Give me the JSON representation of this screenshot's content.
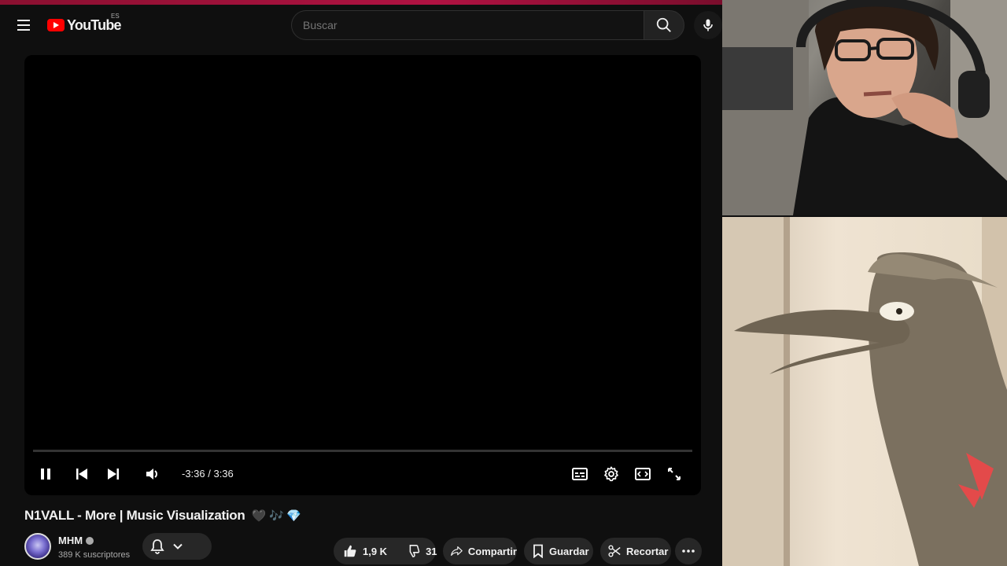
{
  "masthead": {
    "logo_text": "YouTube",
    "region": "ES",
    "search_placeholder": "Buscar"
  },
  "player": {
    "time": "-3:36 / 3:36",
    "progress": 0
  },
  "video": {
    "title": "N1VALL - More | Music Visualization",
    "title_emojis": "🖤 🎶 💎"
  },
  "channel": {
    "name": "MHM",
    "subscribers": "389 K suscriptores"
  },
  "actions": {
    "likes": "1,9 K",
    "dislikes": "31",
    "share": "Compartir",
    "save": "Guardar",
    "clip": "Recortar"
  },
  "colors": {
    "background": "#0f0f0f",
    "brand_red": "#ff0000",
    "pill": "#272727",
    "top_bar": "#b01242"
  }
}
